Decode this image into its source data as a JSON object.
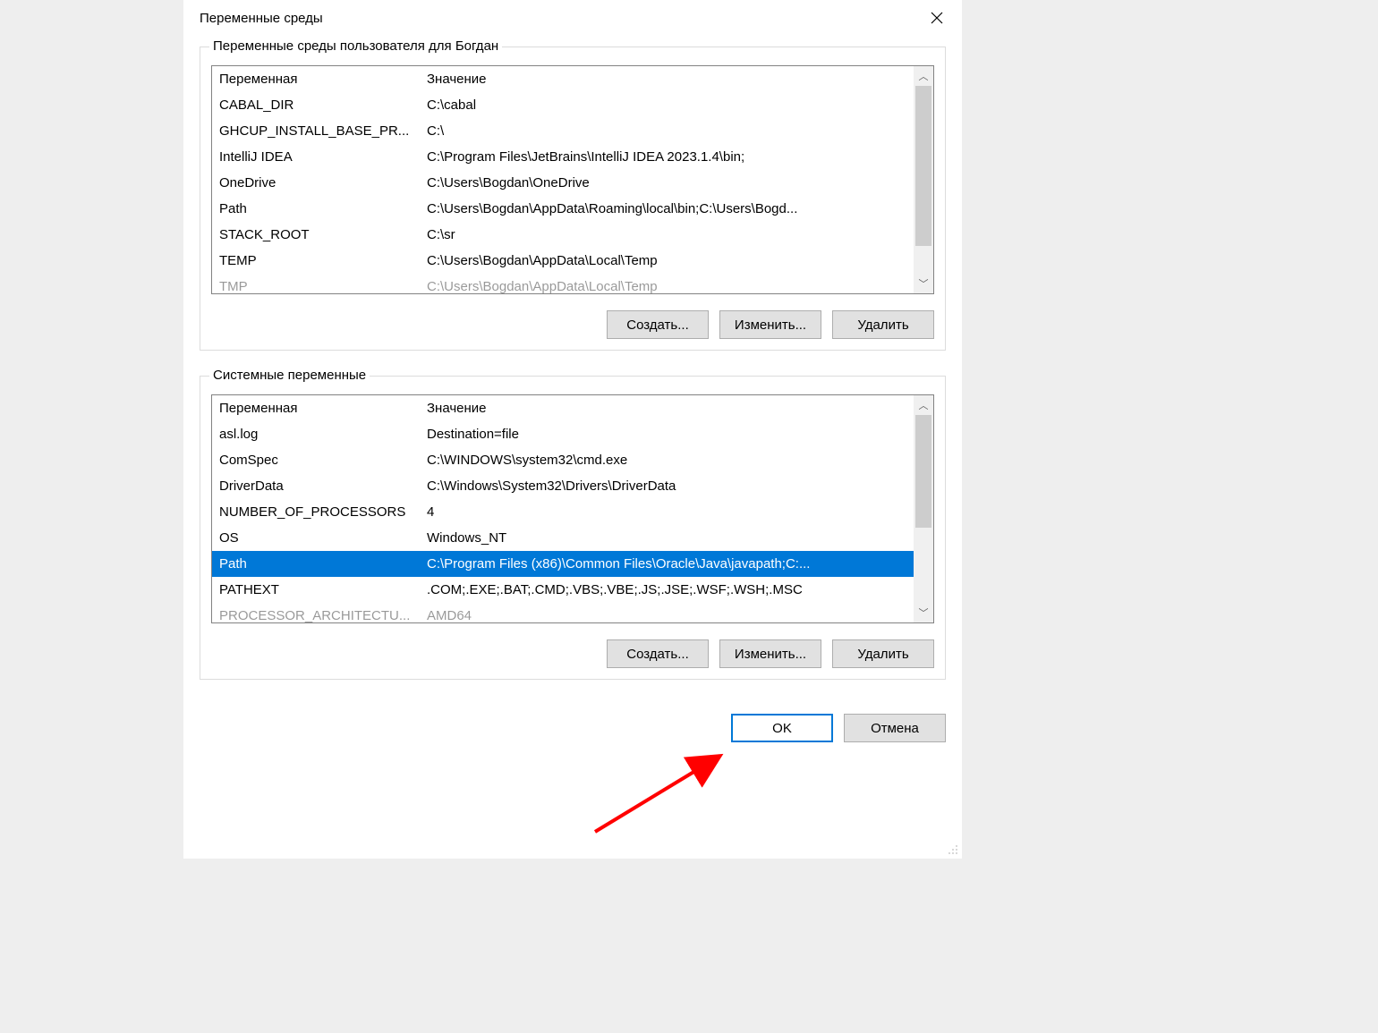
{
  "dialog": {
    "title": "Переменные среды"
  },
  "userVars": {
    "groupLabel": "Переменные среды пользователя для Богдан",
    "header": {
      "col1": "Переменная",
      "col2": "Значение"
    },
    "rows": [
      {
        "name": "CABAL_DIR",
        "value": "C:\\cabal"
      },
      {
        "name": "GHCUP_INSTALL_BASE_PR...",
        "value": "C:\\"
      },
      {
        "name": "IntelliJ IDEA",
        "value": "C:\\Program Files\\JetBrains\\IntelliJ IDEA 2023.1.4\\bin;"
      },
      {
        "name": "OneDrive",
        "value": "C:\\Users\\Bogdan\\OneDrive"
      },
      {
        "name": "Path",
        "value": "C:\\Users\\Bogdan\\AppData\\Roaming\\local\\bin;C:\\Users\\Bogd..."
      },
      {
        "name": "STACK_ROOT",
        "value": "C:\\sr"
      },
      {
        "name": "TEMP",
        "value": "C:\\Users\\Bogdan\\AppData\\Local\\Temp"
      },
      {
        "name": "TMP",
        "value": "C:\\Users\\Bogdan\\AppData\\Local\\Temp"
      }
    ],
    "buttons": {
      "new": "Создать...",
      "edit": "Изменить...",
      "delete": "Удалить"
    }
  },
  "systemVars": {
    "groupLabel": "Системные переменные",
    "header": {
      "col1": "Переменная",
      "col2": "Значение"
    },
    "rows": [
      {
        "name": "asl.log",
        "value": "Destination=file",
        "selected": false
      },
      {
        "name": "ComSpec",
        "value": "C:\\WINDOWS\\system32\\cmd.exe",
        "selected": false
      },
      {
        "name": "DriverData",
        "value": "C:\\Windows\\System32\\Drivers\\DriverData",
        "selected": false
      },
      {
        "name": "NUMBER_OF_PROCESSORS",
        "value": "4",
        "selected": false
      },
      {
        "name": "OS",
        "value": "Windows_NT",
        "selected": false
      },
      {
        "name": "Path",
        "value": "C:\\Program Files (x86)\\Common Files\\Oracle\\Java\\javapath;C:...",
        "selected": true
      },
      {
        "name": "PATHEXT",
        "value": ".COM;.EXE;.BAT;.CMD;.VBS;.VBE;.JS;.JSE;.WSF;.WSH;.MSC",
        "selected": false
      },
      {
        "name": "PROCESSOR_ARCHITECTU...",
        "value": "AMD64",
        "selected": false
      }
    ],
    "buttons": {
      "new": "Создать...",
      "edit": "Изменить...",
      "delete": "Удалить"
    }
  },
  "footer": {
    "ok": "OK",
    "cancel": "Отмена"
  }
}
